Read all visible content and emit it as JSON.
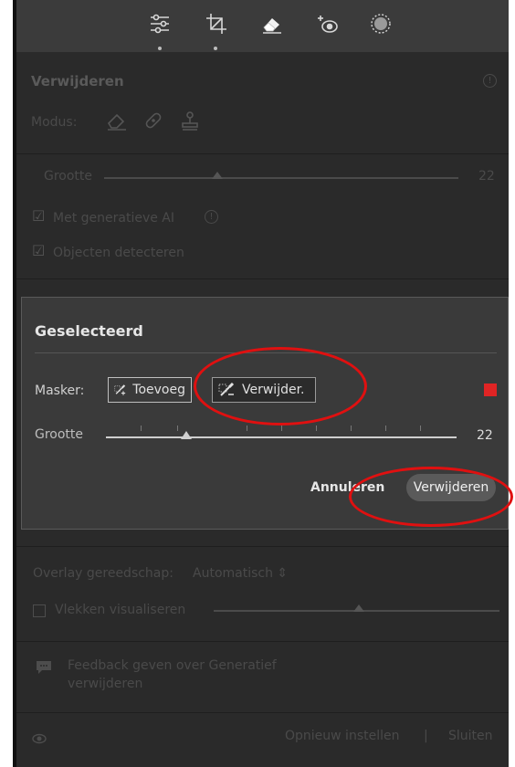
{
  "toolbar": {
    "icons": [
      "sliders-icon",
      "crop-icon",
      "eraser-icon",
      "redeye-icon",
      "mask-icon"
    ]
  },
  "remove_panel": {
    "title": "Verwijderen",
    "modus_label": "Modus:",
    "grootte_label": "Grootte",
    "grootte_value": "22",
    "grootte_level": 0.32,
    "gen_ai_label": "Met generatieve AI",
    "detect_label": "Objecten detecteren"
  },
  "dialog": {
    "title": "Geselecteerd",
    "mask_label": "Masker:",
    "add_button": "Toevoeg",
    "remove_button": "Verwijder.",
    "grootte_label": "Grootte",
    "grootte_value": "22",
    "grootte_level": 0.23,
    "cancel_button": "Annuleren",
    "confirm_button": "Verwijderen",
    "mask_color": "#e02424"
  },
  "bottom": {
    "overlay_label": "Overlay gereedschap:",
    "overlay_value": "Automatisch",
    "spots_label": "Vlekken visualiseren",
    "feedback_text_1": "Feedback geven over Generatief",
    "feedback_text_2": "verwijderen",
    "reset_button": "Opnieuw instellen",
    "close_button": "Sluiten"
  },
  "colors": {
    "annotation": "#e01010"
  }
}
